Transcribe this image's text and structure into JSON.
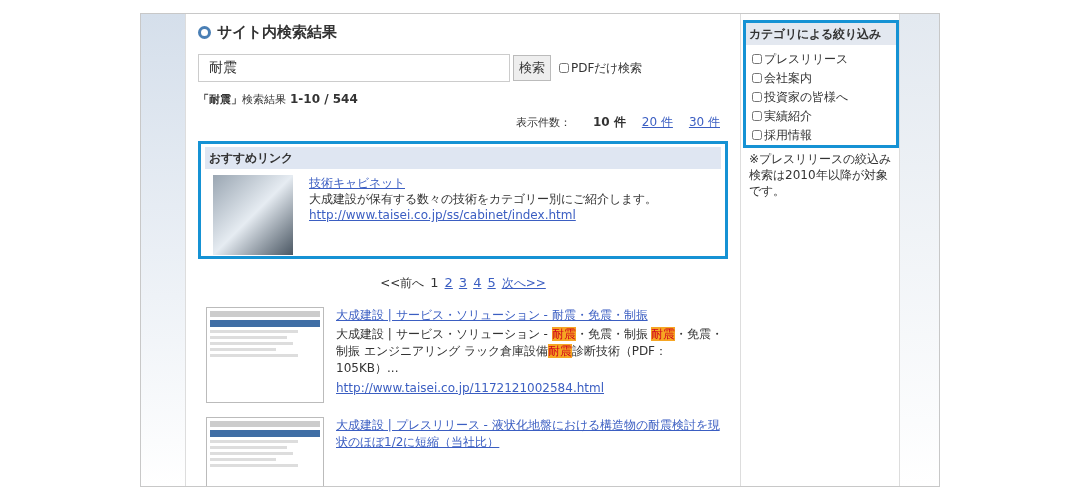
{
  "page_title": "サイト内検索結果",
  "search": {
    "value": "耐震",
    "button": "検索",
    "pdf_only": {
      "label": "PDFだけ検索",
      "checked": false
    }
  },
  "result_summary": {
    "query": "「耐震」",
    "label": "検索結果",
    "range": "1-10 / 544"
  },
  "per_page": {
    "label": "表示件数：",
    "options": [
      {
        "label": "10 件",
        "selected": true
      },
      {
        "label": "20 件",
        "selected": false
      },
      {
        "label": "30 件",
        "selected": false
      }
    ]
  },
  "recommended": {
    "heading": "おすすめリンク",
    "title": "技術キャビネット",
    "description": "大成建設が保有する数々の技術をカテゴリー別にご紹介します。",
    "url": "http://www.taisei.co.jp/ss/cabinet/index.html"
  },
  "pagination": [
    {
      "label": "<<前へ",
      "kind": "text"
    },
    {
      "label": "1",
      "kind": "page",
      "selected": true
    },
    {
      "label": "2",
      "kind": "page",
      "selected": false
    },
    {
      "label": "3",
      "kind": "page",
      "selected": false
    },
    {
      "label": "4",
      "kind": "page",
      "selected": false
    },
    {
      "label": "5",
      "kind": "page",
      "selected": false
    },
    {
      "label": "次へ>>",
      "kind": "link"
    }
  ],
  "results": [
    {
      "title": "大成建設 | サービス・ソリューション - 耐震・免震・制振",
      "snippet": [
        {
          "text": "大成建設 | サービス・ソリューション - ",
          "highlight": false
        },
        {
          "text": "耐震",
          "highlight": true
        },
        {
          "text": "・免震・制振 ",
          "highlight": false
        },
        {
          "text": "耐震",
          "highlight": true
        },
        {
          "text": "・免震・制振 エンジニアリング ラック倉庫設備",
          "highlight": false
        },
        {
          "text": "耐震",
          "highlight": true
        },
        {
          "text": "診断技術（PDF：105KB）...",
          "highlight": false
        }
      ],
      "url": "http://www.taisei.co.jp/1172121002584.html"
    },
    {
      "title": "大成建設 | プレスリリース - 液状化地盤における構造物の耐震検討を現状のほぼ1/2に短縮（当社比）"
    }
  ],
  "sidebar": {
    "heading": "カテゴリによる絞り込み",
    "categories": [
      {
        "label": "プレスリリース",
        "checked": false
      },
      {
        "label": "会社案内",
        "checked": false
      },
      {
        "label": "投資家の皆様へ",
        "checked": false
      },
      {
        "label": "実績紹介",
        "checked": false
      },
      {
        "label": "採用情報",
        "checked": false
      }
    ],
    "note": "※プレスリリースの絞込み検索は2010年以降が対象です。"
  }
}
